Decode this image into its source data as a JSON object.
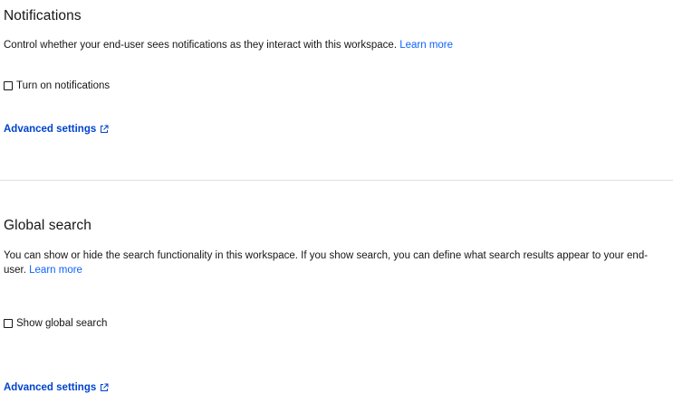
{
  "notifications": {
    "title": "Notifications",
    "description": "Control whether your end-user sees notifications as they interact with this workspace.",
    "learn_more": "Learn more",
    "checkbox_label": "Turn on notifications",
    "checkbox_checked": false,
    "advanced_settings": "Advanced settings"
  },
  "global_search": {
    "title": "Global search",
    "description": "You can show or hide the search functionality in this workspace. If you show search, you can define what search results appear to your end-user.",
    "learn_more": "Learn more",
    "checkbox_label": "Show global search",
    "checkbox_checked": false,
    "advanced_settings": "Advanced settings"
  },
  "colors": {
    "link": "#0f62fe",
    "divider": "#e0e0e0",
    "text": "#161616"
  },
  "icons": {
    "external_link": "external-link-icon"
  }
}
